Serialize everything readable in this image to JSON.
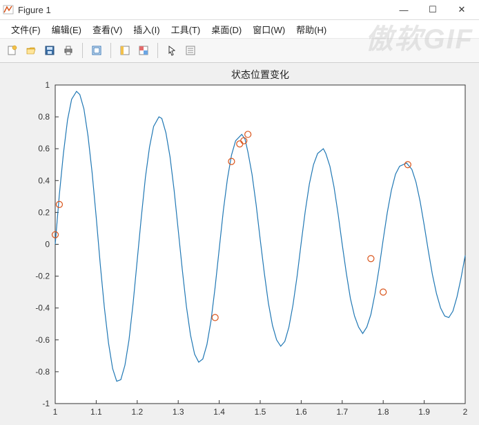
{
  "window": {
    "title": "Figure 1",
    "controls": {
      "min": "—",
      "max": "☐",
      "close": "✕"
    }
  },
  "menu": {
    "file": "文件(F)",
    "edit": "编辑(E)",
    "view": "查看(V)",
    "insert": "插入(I)",
    "tools": "工具(T)",
    "desktop": "桌面(D)",
    "window": "窗口(W)",
    "help": "帮助(H)"
  },
  "toolbar": {
    "new": "new-figure-icon",
    "open": "open-icon",
    "save": "save-icon",
    "print": "print-icon",
    "zoom": "zoom-icon",
    "split1": "layout1-icon",
    "split2": "layout2-icon",
    "arrow": "arrow-icon",
    "list": "panel-icon"
  },
  "watermark": "傲软GIF",
  "chart_data": {
    "type": "line+scatter",
    "title": "状态位置变化",
    "xlabel": "",
    "ylabel": "",
    "xlim": [
      1,
      2
    ],
    "ylim": [
      -1,
      1
    ],
    "xticks": [
      1,
      1.1,
      1.2,
      1.3,
      1.4,
      1.5,
      1.6,
      1.7,
      1.8,
      1.9,
      2
    ],
    "yticks": [
      -1,
      -0.8,
      -0.6,
      -0.4,
      -0.2,
      0,
      0.2,
      0.4,
      0.6,
      0.8,
      1
    ],
    "series": [
      {
        "name": "line",
        "style": "line",
        "color": "#1f77b4",
        "x": [
          1.0,
          1.01,
          1.02,
          1.03,
          1.04,
          1.052,
          1.06,
          1.07,
          1.08,
          1.09,
          1.1,
          1.11,
          1.12,
          1.13,
          1.14,
          1.15,
          1.16,
          1.17,
          1.18,
          1.19,
          1.2,
          1.21,
          1.22,
          1.23,
          1.24,
          1.253,
          1.26,
          1.27,
          1.28,
          1.29,
          1.3,
          1.31,
          1.32,
          1.33,
          1.34,
          1.35,
          1.36,
          1.37,
          1.38,
          1.39,
          1.4,
          1.41,
          1.42,
          1.43,
          1.44,
          1.455,
          1.463,
          1.47,
          1.48,
          1.49,
          1.5,
          1.51,
          1.52,
          1.53,
          1.54,
          1.55,
          1.56,
          1.57,
          1.58,
          1.59,
          1.6,
          1.61,
          1.62,
          1.63,
          1.64,
          1.654,
          1.66,
          1.67,
          1.68,
          1.69,
          1.7,
          1.71,
          1.72,
          1.73,
          1.74,
          1.75,
          1.76,
          1.77,
          1.78,
          1.79,
          1.8,
          1.81,
          1.82,
          1.83,
          1.84,
          1.857,
          1.87,
          1.88,
          1.89,
          1.9,
          1.91,
          1.92,
          1.93,
          1.94,
          1.95,
          1.96,
          1.97,
          1.98,
          1.99,
          2.0
        ],
        "y": [
          0.0,
          0.31,
          0.57,
          0.78,
          0.91,
          0.96,
          0.94,
          0.85,
          0.68,
          0.45,
          0.17,
          -0.13,
          -0.4,
          -0.62,
          -0.78,
          -0.86,
          -0.85,
          -0.76,
          -0.6,
          -0.37,
          -0.1,
          0.17,
          0.42,
          0.61,
          0.74,
          0.8,
          0.79,
          0.7,
          0.55,
          0.34,
          0.09,
          -0.16,
          -0.39,
          -0.57,
          -0.69,
          -0.74,
          -0.72,
          -0.63,
          -0.48,
          -0.27,
          -0.03,
          0.21,
          0.41,
          0.56,
          0.65,
          0.69,
          0.66,
          0.58,
          0.44,
          0.25,
          0.03,
          -0.18,
          -0.37,
          -0.51,
          -0.6,
          -0.64,
          -0.61,
          -0.52,
          -0.38,
          -0.2,
          0.01,
          0.21,
          0.38,
          0.5,
          0.57,
          0.6,
          0.57,
          0.49,
          0.36,
          0.19,
          0.0,
          -0.18,
          -0.34,
          -0.45,
          -0.52,
          -0.56,
          -0.52,
          -0.44,
          -0.31,
          -0.15,
          0.03,
          0.2,
          0.34,
          0.44,
          0.49,
          0.51,
          0.47,
          0.39,
          0.27,
          0.12,
          -0.04,
          -0.19,
          -0.31,
          -0.4,
          -0.45,
          -0.46,
          -0.42,
          -0.33,
          -0.21,
          -0.07
        ]
      },
      {
        "name": "markers",
        "style": "scatter",
        "color": "#d95319",
        "points": [
          {
            "x": 1.0,
            "y": 0.06
          },
          {
            "x": 1.01,
            "y": 0.25
          },
          {
            "x": 1.39,
            "y": -0.46
          },
          {
            "x": 1.43,
            "y": 0.52
          },
          {
            "x": 1.45,
            "y": 0.63
          },
          {
            "x": 1.46,
            "y": 0.65
          },
          {
            "x": 1.47,
            "y": 0.69
          },
          {
            "x": 1.77,
            "y": -0.09
          },
          {
            "x": 1.8,
            "y": -0.3
          },
          {
            "x": 1.86,
            "y": 0.5
          }
        ]
      }
    ]
  }
}
